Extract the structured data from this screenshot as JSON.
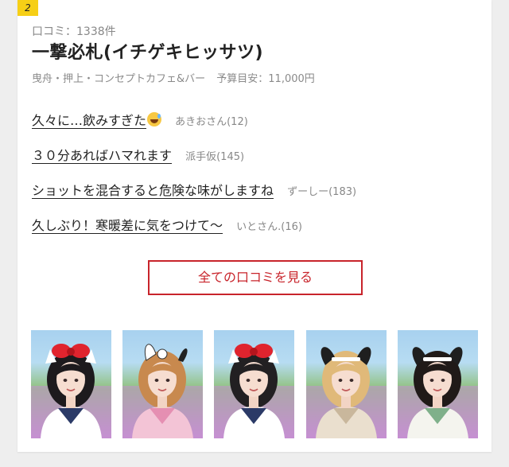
{
  "rank": "2",
  "shop": {
    "review_count": "口コミ：1338件",
    "name": "一撃必札(イチゲキヒッサツ)",
    "area": "曳舟・押上・コンセプトカフェ&バー",
    "budget": "予算目安：11,000円"
  },
  "reviews": [
    {
      "title": "久々に…飲みすぎた",
      "author": "あきおさん(12)",
      "emoji": "sweat-smile-icon"
    },
    {
      "title": "３０分あればハマれます",
      "author": "派手仮(145)"
    },
    {
      "title": "ショットを混合すると危険な味がしますね",
      "author": "ずーしー(183)"
    },
    {
      "title": "久しぶり！寒暖差に気をつけて〜",
      "author": "いとさん.(16)"
    }
  ],
  "all_reviews_label": "全ての口コミを見る",
  "photos": [
    {
      "name": "cast-photo-1",
      "accessory": "red-bow",
      "hair": "#1d1a1d",
      "outfit": "sailor"
    },
    {
      "name": "cast-photo-2",
      "accessory": "skull-ears",
      "hair": "#c8894e",
      "outfit": "pink"
    },
    {
      "name": "cast-photo-3",
      "accessory": "red-bow",
      "hair": "#222022",
      "outfit": "sailor"
    },
    {
      "name": "cast-photo-4",
      "accessory": "black-ears",
      "hair": "#e0b979",
      "outfit": "beige"
    },
    {
      "name": "cast-photo-5",
      "accessory": "black-ears",
      "hair": "#201a18",
      "outfit": "sailor-green"
    }
  ],
  "colors": {
    "badge": "#f6cf16",
    "accent_red": "#c8242b"
  }
}
